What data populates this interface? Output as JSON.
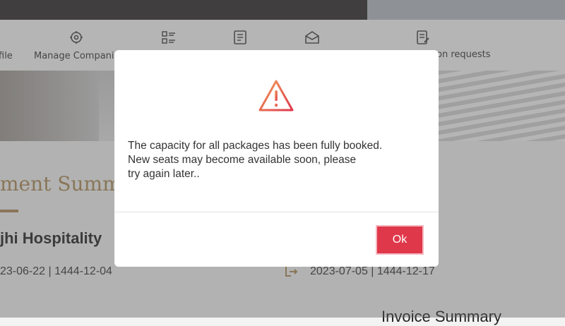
{
  "nav": {
    "items": [
      {
        "label": "file",
        "icon": "profile-icon"
      },
      {
        "label": "Manage Companic",
        "icon": "companions-icon"
      },
      {
        "label": "",
        "icon": "list-icon"
      },
      {
        "label": "",
        "icon": "document-icon"
      },
      {
        "label": "",
        "icon": "envelope-icon"
      },
      {
        "label": "on requests",
        "icon": "request-icon"
      }
    ]
  },
  "page": {
    "summary_title": "ment Summ",
    "hotel_name": "jhi Hospitality",
    "checkin_date": "23-06-22 | 1444-12-04",
    "checkout_date": "2023-07-05 | 1444-12-17",
    "invoice_title": "Invoice Summary"
  },
  "modal": {
    "icon": "warning-icon",
    "message_line1": "The capacity for all packages has been fully booked.",
    "message_line2": "New seats may become available soon, please",
    "message_line3": "try again later..",
    "ok_label": "Ok"
  },
  "colors": {
    "accent_gold": "#b08d57",
    "ok_button": "#e0384b",
    "warning_gradient_start": "#f0a05a",
    "warning_gradient_end": "#e0384b"
  }
}
